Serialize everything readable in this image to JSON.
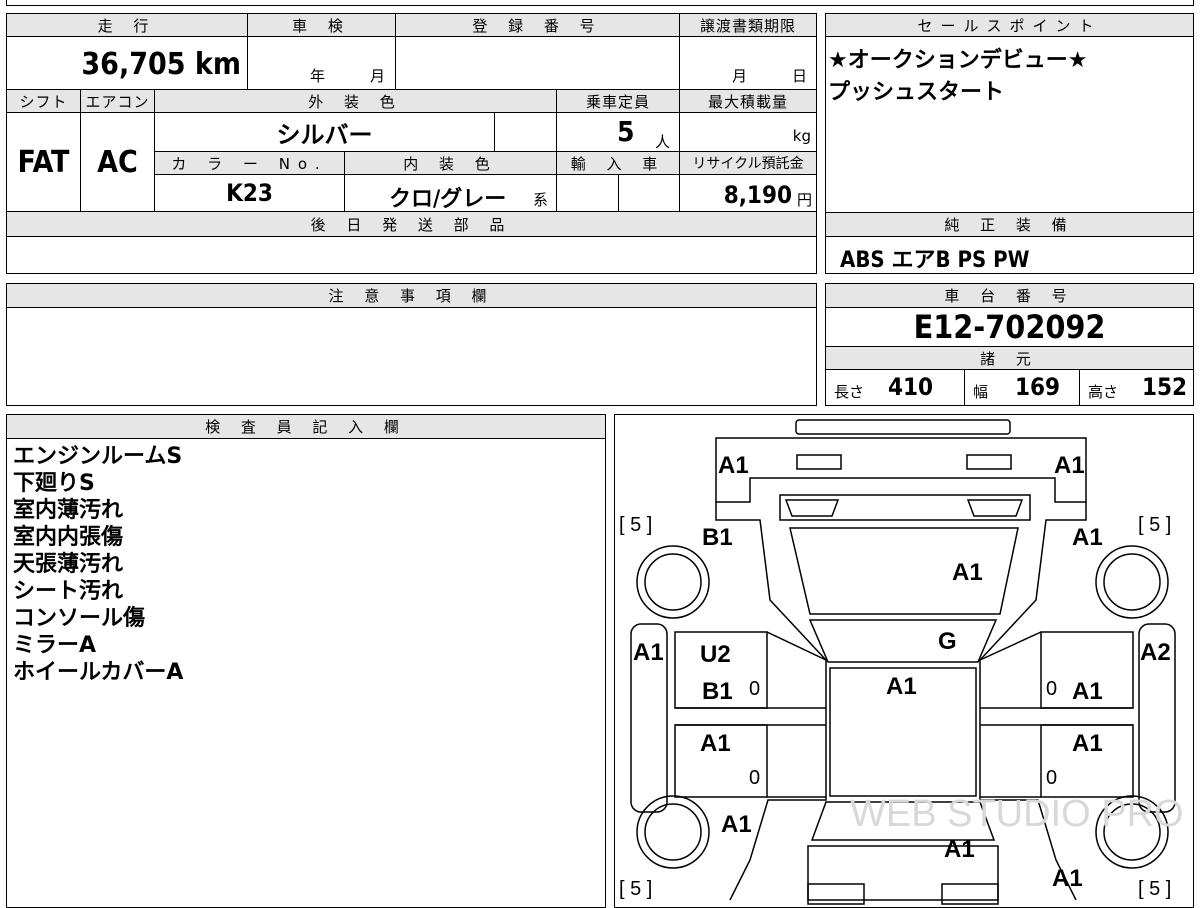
{
  "top_strip": {
    "text": ""
  },
  "vehicle": {
    "mileage_header": "走 行",
    "mileage": "36,705 km",
    "shaken_header": "車 検",
    "shaken_year_unit": "年",
    "shaken_month_unit": "月",
    "registration_header": "登 録 番 号",
    "transfer_header": "譲渡書類期限",
    "transfer_month_unit": "月",
    "transfer_day_unit": "日",
    "shift_header": "シフト",
    "shift": "FAT",
    "ac_header": "エアコン",
    "ac": "AC",
    "exterior_color_header": "外 装 色",
    "exterior_color": "シルバー",
    "capacity_header": "乗車定員",
    "capacity": "5",
    "capacity_unit": "人",
    "max_load_header": "最大積載量",
    "max_load_unit": "kg",
    "color_no_header": "カ ラ ー No.",
    "color_no": "K23",
    "interior_color_header": "内 装 色",
    "interior_color": "クロ/グレー",
    "interior_suffix": "系",
    "import_header": "輸 入 車",
    "recycle_header": "リサイクル預託金",
    "recycle_fee": "8,190",
    "recycle_unit": "円",
    "later_parts_header": "後 日 発 送 部 品"
  },
  "sales_point": {
    "header": "セールスポイント",
    "lines": [
      "★オークションデビュー★",
      "プッシュスタート"
    ]
  },
  "standard_equipment": {
    "header": "純 正 装 備",
    "value": "ABS エアB PS PW"
  },
  "notes": {
    "header": "注 意 事 項 欄"
  },
  "chassis": {
    "header": "車 台 番 号",
    "number": "E12-702092"
  },
  "specs": {
    "header": "諸 元",
    "length_label": "長さ",
    "length": "410",
    "width_label": "幅",
    "width": "169",
    "height_label": "高さ",
    "height": "152"
  },
  "inspector": {
    "header": "検 査 員 記 入 欄",
    "lines": [
      "エンジンルームS",
      "下廻りS",
      "室内薄汚れ",
      "室内内張傷",
      "天張薄汚れ",
      "シート汚れ",
      "コンソール傷",
      "ミラーA",
      "ホイールカバーA"
    ]
  },
  "diagram": {
    "tire_fl": "[ 5 ]",
    "tire_fr": "[ 5 ]",
    "tire_rl": "[ 5 ]",
    "tire_rr": "[ 5 ]",
    "front_bumper_left": "A1",
    "front_bumper_right": "A1",
    "fender_left": "B1",
    "fender_right": "A1",
    "hood": "A1",
    "windshield": "G",
    "pillar_left": "A1",
    "pillar_right": "A2",
    "front_door_left_1": "U2",
    "front_door_left_2": "B1",
    "front_door_right": "A1",
    "roof": "A1",
    "rear_door_left": "A1",
    "rear_door_right": "A1",
    "rear_fender_left": "A1",
    "trunk": "A1",
    "rear_right": "A1",
    "zero_1": "0",
    "zero_2": "0",
    "zero_3": "0",
    "zero_4": "0",
    "watermark": "WEB STUDIO PRO"
  }
}
